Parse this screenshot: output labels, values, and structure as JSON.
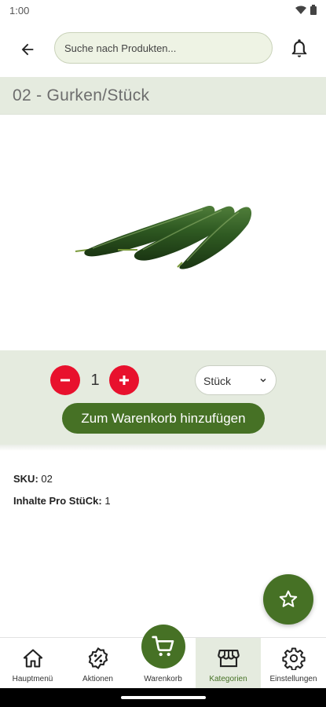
{
  "status_bar": {
    "time": "1:00"
  },
  "search": {
    "placeholder": "Suche nach Produkten..."
  },
  "product": {
    "title": "02 - Gurken/Stück",
    "quantity": "1",
    "unit": "Stück",
    "add_to_cart_label": "Zum Warenkorb hinzufügen",
    "sku_label": "SKU:",
    "sku_value": "02",
    "content_label": "Inhalte Pro StüCk:",
    "content_value": "1"
  },
  "bottom_nav": {
    "items": [
      {
        "label": "Hauptmenü",
        "icon": "home-icon"
      },
      {
        "label": "Aktionen",
        "icon": "discount-icon"
      },
      {
        "label": "Warenkorb",
        "icon": "cart-icon"
      },
      {
        "label": "Kategorien",
        "icon": "store-icon"
      },
      {
        "label": "Einstellungen",
        "icon": "gear-icon"
      }
    ],
    "active": "Kategorien"
  },
  "colors": {
    "primary_green": "#467125",
    "panel_green": "#e5ebdf",
    "qty_red": "#e8112d"
  }
}
